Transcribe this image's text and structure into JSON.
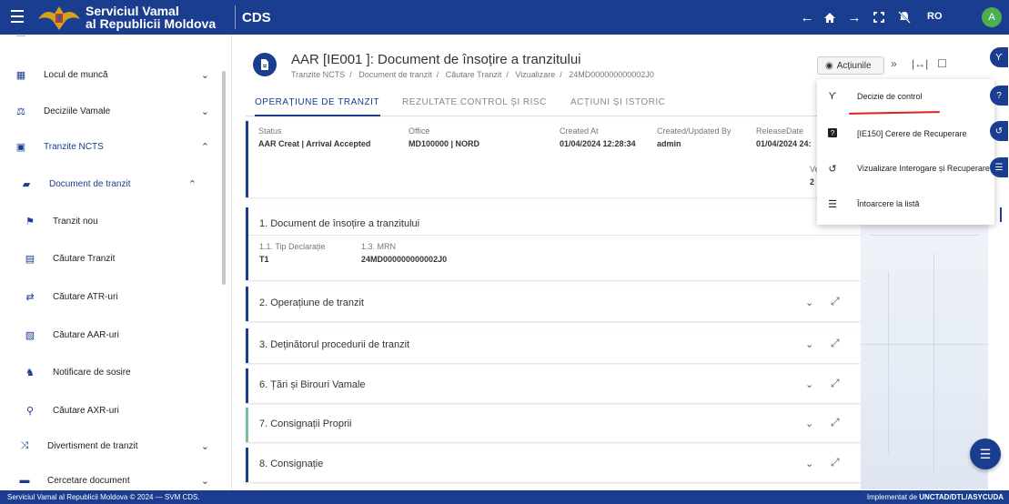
{
  "topbar": {
    "brand_line1": "Serviciul Vamal",
    "brand_line2": "al Republicii Moldova",
    "app_name": "CDS",
    "language": "RO",
    "user_initial": "A",
    "icons": [
      "menu-icon",
      "arrow-left-icon",
      "home-icon",
      "arrow-right-icon",
      "fullscreen-icon",
      "notifications-off-icon"
    ]
  },
  "sidebar": {
    "partial_top": "—",
    "items": [
      {
        "label": "Locul de muncă",
        "icon": "workplace-icon",
        "chevron": "⌄"
      },
      {
        "label": "Deciziile Vamale",
        "icon": "decisions-icon",
        "chevron": "⌄"
      },
      {
        "label": "Tranzite NCTS",
        "icon": "transit-icon",
        "chevron": "⌃"
      },
      {
        "label": "Document de tranzit",
        "icon": "truck-icon",
        "chevron": "⌃"
      },
      {
        "label": "Tranzit nou",
        "icon": "new-transit-icon"
      },
      {
        "label": "Căutare Tranzit",
        "icon": "search-document-icon"
      },
      {
        "label": "Căutare ATR-uri",
        "icon": "atr-icon"
      },
      {
        "label": "Căutare AAR-uri",
        "icon": "aar-icon"
      },
      {
        "label": "Notificare de sosire",
        "icon": "arrival-icon"
      },
      {
        "label": "Căutare AXR-uri",
        "icon": "axr-icon"
      },
      {
        "label": "Divertisment de tranzit",
        "icon": "diversion-icon",
        "chevron": "⌄"
      },
      {
        "label": "Cercetare document",
        "icon": "research-icon",
        "chevron": "⌄"
      }
    ]
  },
  "header": {
    "title": "AAR [IE001 ]: Document de însoțire a tranzitului",
    "breadcrumb": [
      "Tranzite NCTS",
      "Document de tranzit",
      "Căutare Tranzit",
      "Vizualizare",
      "24MD000000000002J0"
    ],
    "actions_label": "Acțiunile"
  },
  "tabs": [
    "OPERAȚIUNE DE TRANZIT",
    "REZULTATE CONTROL ȘI RISC",
    "ACȚIUNI ȘI ISTORIC"
  ],
  "status": {
    "labels": [
      "Status",
      "Office",
      "Created At",
      "Created/Updated By",
      "ReleaseDate"
    ],
    "values": [
      "AAR Creat | Arrival Accepted",
      "MD100000 | NORD",
      "01/04/2024 12:28:34",
      "admin",
      "01/04/2024 24:"
    ],
    "extra_label": "Ve",
    "extra_value": "2 |"
  },
  "sections": {
    "open": {
      "title": "1. Document de însoțire a tranzitului",
      "field1_label": "1.1. Tip Declarație",
      "field1_value": "T1",
      "field2_label": "1.3. MRN",
      "field2_value": "24MD000000000002J0"
    },
    "collapsed": [
      {
        "title": "2. Operațiune de tranzit"
      },
      {
        "title": "3. Deținătorul procedurii de tranzit"
      },
      {
        "title": "6. Țări și Birouri Vamale"
      },
      {
        "title": "7. Consignații Proprii"
      },
      {
        "title": "8. Consignație"
      }
    ]
  },
  "menu": {
    "items": [
      {
        "label": "Decizie de control",
        "icon": "control-decision-icon"
      },
      {
        "label": "[IE150] Cerere de Recuperare",
        "icon": "help-icon"
      },
      {
        "label": "Vizualizare Interogare și Recuperare",
        "icon": "history-icon"
      },
      {
        "label": "Întoarcere la listă",
        "icon": "list-icon"
      }
    ]
  },
  "footer": {
    "left": "Serviciul Vamal al Republicii Moldova © 2024 — SVM CDS.",
    "right_prefix": "Implementat de ",
    "right_bold": "UNCTAD/DTL/ASYCUDA"
  },
  "colors": {
    "primary": "#1a3d8f",
    "accent_green": "#7bbf9e",
    "underline_red": "#e02020"
  }
}
